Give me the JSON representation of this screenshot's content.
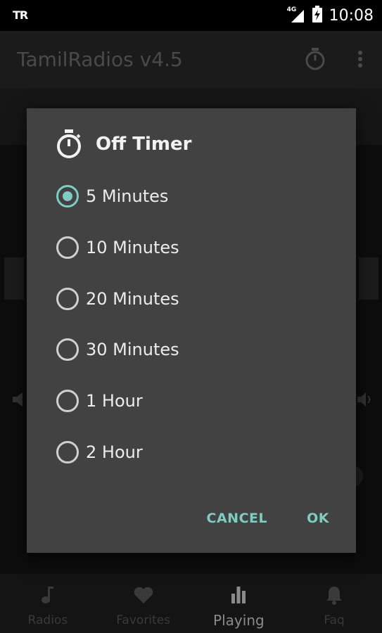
{
  "status_bar": {
    "carrier": "TR",
    "network": "4G",
    "time": "10:08"
  },
  "app_bar": {
    "title": "TamilRadios v4.5",
    "icons": [
      "stopwatch-icon",
      "more-vert-icon"
    ]
  },
  "dialog": {
    "title": "Off Timer",
    "title_icon": "stopwatch-icon",
    "options": [
      {
        "label": "5 Minutes",
        "checked": true
      },
      {
        "label": "10 Minutes",
        "checked": false
      },
      {
        "label": "20 Minutes",
        "checked": false
      },
      {
        "label": "30 Minutes",
        "checked": false
      },
      {
        "label": "1 Hour",
        "checked": false
      },
      {
        "label": "2 Hour",
        "checked": false
      }
    ],
    "cancel_label": "CANCEL",
    "ok_label": "OK",
    "accent_color": "#80cbc4"
  },
  "bottom_nav": {
    "items": [
      {
        "label": "Radios",
        "icon": "music-note-icon"
      },
      {
        "label": "Favorites",
        "icon": "heart-icon"
      },
      {
        "label": "Playing",
        "icon": "equalizer-icon",
        "active": true
      },
      {
        "label": "Faq",
        "icon": "bell-icon"
      }
    ]
  }
}
